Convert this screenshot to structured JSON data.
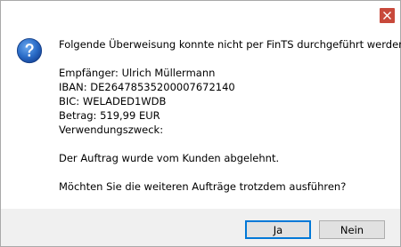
{
  "window": {
    "close_icon": "close-icon"
  },
  "dialog": {
    "icon": "question-icon",
    "intro": "Folgende Überweisung konnte nicht per FinTS durchgeführt werden:",
    "recipient": "Empfänger: Ulrich Müllermann",
    "iban": "IBAN: DE26478535200007672140",
    "bic": "BIC: WELADED1WDB",
    "amount": "Betrag: 519,99 EUR",
    "purpose": "Verwendungszweck:",
    "rejection": "Der Auftrag wurde vom Kunden abgelehnt.",
    "question": "Möchten Sie die weiteren Aufträge trotzdem ausführen?"
  },
  "buttons": {
    "yes_label": "Ja",
    "no_label": "Nein"
  },
  "colors": {
    "close_button": "#c8493b",
    "icon_blue": "#1f5fb4",
    "footer_background": "#f0f0f0",
    "default_button_border": "#0078d7"
  }
}
